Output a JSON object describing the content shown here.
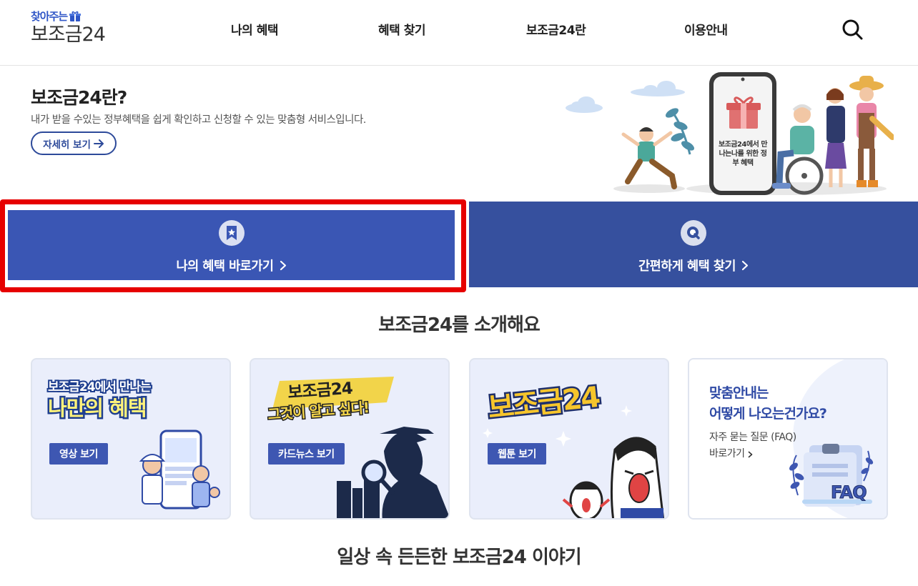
{
  "header": {
    "logo_sub": "찾아주는",
    "logo_main": "보조금24",
    "nav": [
      "나의 혜택",
      "혜택 찾기",
      "보조금24란",
      "이용안내"
    ]
  },
  "intro": {
    "title": "보조금24란?",
    "desc": "내가 받을 수있는 정부혜택을 쉽게 확인하고 신청할 수 있는 맞춤형 서비스입니다.",
    "more_label": "자세히 보기",
    "phone_text": "보조금24에서 만나는나를 위한 정부 혜택"
  },
  "cta": {
    "left_label": "나의 혜택 바로가기",
    "right_label": "간편하게 혜택 찾기"
  },
  "section1_title": "보조금24를 소개해요",
  "cards": [
    {
      "button": "영상 보기",
      "art_text_1": "보조금24에서 만나는",
      "art_text_2": "나만의 혜택"
    },
    {
      "button": "카드뉴스 보기",
      "art_text_1": "보조금24",
      "art_text_2": "그것이 알고 싶다!"
    },
    {
      "button": "웹툰 보기",
      "art_text_1": "보조금24"
    }
  ],
  "faq": {
    "title_1": "맞춤안내는",
    "title_2": "어떻게 나오는건가요?",
    "sub": "자주 묻는 질문 (FAQ)",
    "link": "바로가기",
    "badge": "FAQ"
  },
  "section2_title": "일상 속 든든한 보조금24 이야기",
  "colors": {
    "primary_blue": "#3a56b4",
    "cta_right_blue": "#36509e",
    "highlight_red": "#e60000",
    "card_bg": "#eaeefb"
  }
}
